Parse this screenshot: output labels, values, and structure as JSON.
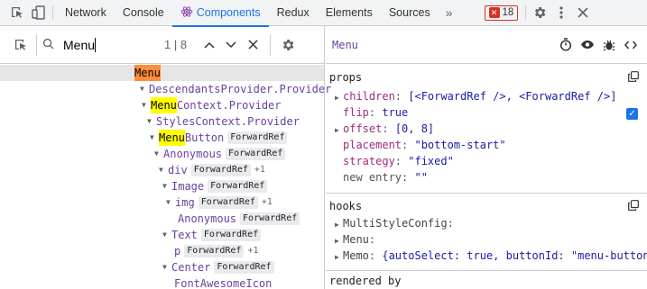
{
  "topbar": {
    "tabs": [
      "Network",
      "Console",
      "Components",
      "Redux",
      "Elements",
      "Sources"
    ],
    "active_tab": "Components",
    "more": "»",
    "error_count": "18",
    "accent": "#1a73e8"
  },
  "search": {
    "value": "Menu",
    "match_count": "1 | 8"
  },
  "tree": [
    {
      "name": "Menu",
      "highlight": "Menu",
      "rest": "",
      "badge": "",
      "plus": "",
      "selected": true
    },
    {
      "name": "DescendantsProvider.Provider",
      "badge": "",
      "plus": ""
    },
    {
      "highlight": "Menu",
      "rest": "Context.Provider",
      "badge": "",
      "plus": ""
    },
    {
      "name": "StylesContext.Provider",
      "badge": "",
      "plus": ""
    },
    {
      "highlight": "Menu",
      "rest": "Button",
      "badge": "ForwardRef",
      "plus": ""
    },
    {
      "name": "Anonymous",
      "badge": "ForwardRef",
      "plus": ""
    },
    {
      "name": "div",
      "badge": "ForwardRef",
      "plus": "+1"
    },
    {
      "name": "Image",
      "badge": "ForwardRef",
      "plus": ""
    },
    {
      "name": "img",
      "badge": "ForwardRef",
      "plus": "+1"
    },
    {
      "name": "Anonymous",
      "badge": "ForwardRef",
      "plus": ""
    },
    {
      "name": "Text",
      "badge": "ForwardRef",
      "plus": ""
    },
    {
      "name": "p",
      "badge": "ForwardRef",
      "plus": "+1"
    },
    {
      "name": "Center",
      "badge": "ForwardRef",
      "plus": ""
    },
    {
      "name": "FontAwesomeIcon",
      "badge": "",
      "plus": ""
    }
  ],
  "inspector": {
    "title": "Menu",
    "props_title": "props",
    "props": [
      {
        "key": "children",
        "value": "[<ForwardRef />, <ForwardRef />]"
      },
      {
        "key": "flip",
        "value": "true"
      },
      {
        "key": "offset",
        "value": "[0, 8]"
      },
      {
        "key": "placement",
        "value": "\"bottom-start\""
      },
      {
        "key": "strategy",
        "value": "\"fixed\""
      },
      {
        "key": "new entry",
        "value": "\"\""
      }
    ],
    "hooks_title": "hooks",
    "hooks": [
      {
        "key": "MultiStyleConfig",
        "value": ""
      },
      {
        "key": "Menu",
        "value": ""
      },
      {
        "key": "Memo",
        "value": "{autoSelect: true, buttonId: \"menu-button-…"
      }
    ],
    "rendered_by_title": "rendered by"
  }
}
